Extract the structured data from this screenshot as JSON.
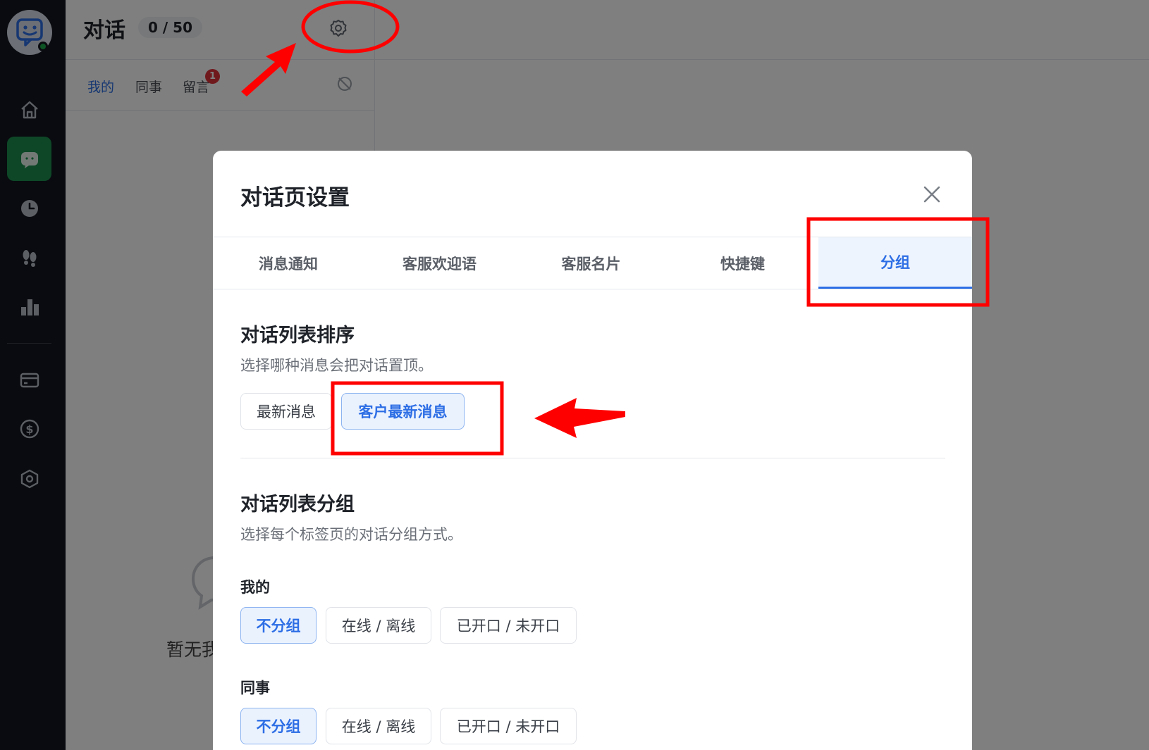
{
  "app": {
    "accent": "#2d6ee5",
    "sidebar_bg": "#131720",
    "annotation_color": "#ff0000"
  },
  "sidebar": {
    "logo_icon": "bot-chat-icon",
    "items": [
      {
        "icon": "home-icon",
        "active": false
      },
      {
        "icon": "chat-icon",
        "active": true
      },
      {
        "icon": "clock-icon",
        "active": false
      },
      {
        "icon": "footprints-icon",
        "active": false
      },
      {
        "icon": "bar-chart-icon",
        "active": false
      },
      {
        "icon": "card-icon",
        "active": false
      },
      {
        "icon": "dollar-icon",
        "active": false
      },
      {
        "icon": "settings-hex-icon",
        "active": false
      }
    ]
  },
  "header": {
    "title": "对话",
    "count": "0 / 50",
    "settings_icon": "gear-icon"
  },
  "conv_tabs": {
    "items": [
      {
        "label": "我的",
        "active": true
      },
      {
        "label": "同事",
        "active": false
      },
      {
        "label": "留言",
        "badge": "1",
        "active": false
      }
    ],
    "toggle_icon": "notification-off-icon"
  },
  "empty": {
    "text": "暂无我"
  },
  "modal": {
    "title": "对话页设置",
    "tabs": [
      {
        "label": "消息通知",
        "active": false
      },
      {
        "label": "客服欢迎语",
        "active": false
      },
      {
        "label": "客服名片",
        "active": false
      },
      {
        "label": "快捷键",
        "active": false
      },
      {
        "label": "分组",
        "active": true
      }
    ],
    "sort": {
      "title": "对话列表排序",
      "desc": "选择哪种消息会把对话置顶。",
      "options": [
        {
          "label": "最新消息",
          "selected": false
        },
        {
          "label": "客户最新消息",
          "selected": true
        }
      ]
    },
    "group": {
      "title": "对话列表分组",
      "desc": "选择每个标签页的对话分组方式。",
      "rows": [
        {
          "label": "我的",
          "options": [
            {
              "label": "不分组",
              "selected": true
            },
            {
              "label": "在线 / 离线",
              "selected": false
            },
            {
              "label": "已开口 / 未开口",
              "selected": false
            }
          ]
        },
        {
          "label": "同事",
          "options": [
            {
              "label": "不分组",
              "selected": true
            },
            {
              "label": "在线 / 离线",
              "selected": false
            },
            {
              "label": "已开口 / 未开口",
              "selected": false
            }
          ]
        }
      ]
    }
  }
}
